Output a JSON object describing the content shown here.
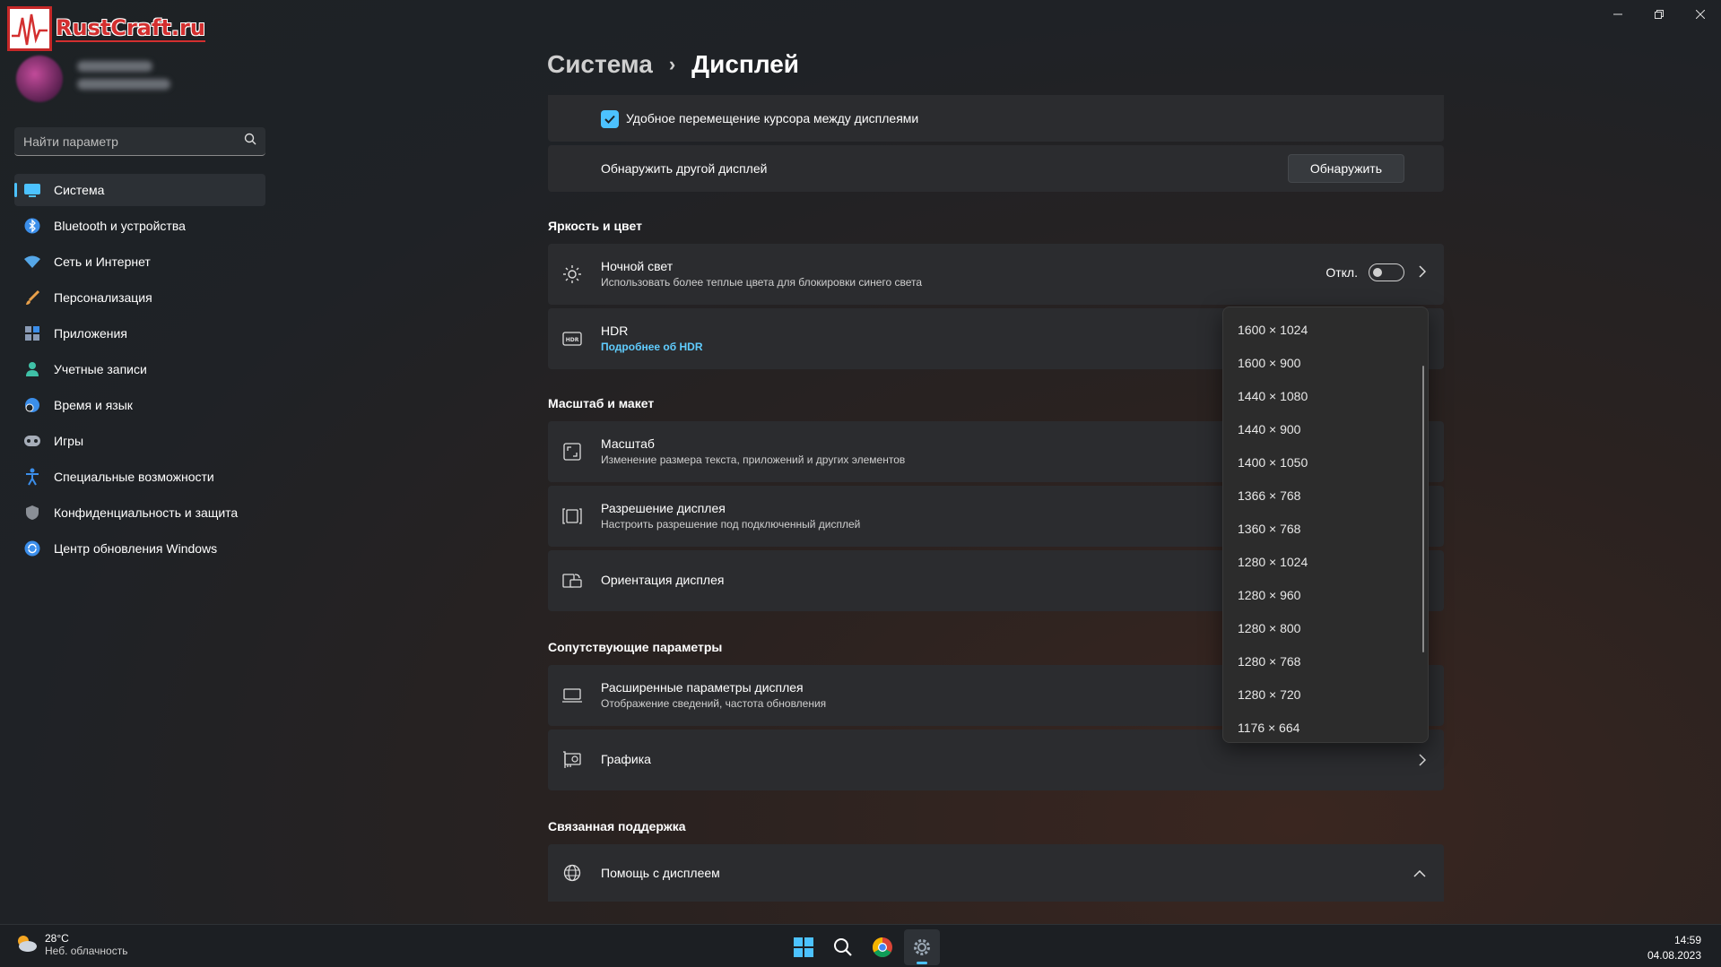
{
  "watermark": {
    "text": "RustCraft.ru"
  },
  "window": {
    "minimize": "–",
    "maximize": "⧉",
    "close": "✕"
  },
  "search": {
    "placeholder": "Найти параметр"
  },
  "sidebar": {
    "items": [
      {
        "label": "Система",
        "icon": "system-icon",
        "color": "#4cc2ff",
        "active": true
      },
      {
        "label": "Bluetooth и устройства",
        "icon": "bluetooth-icon",
        "color": "#3b8eea"
      },
      {
        "label": "Сеть и Интернет",
        "icon": "wifi-icon",
        "color": "#55a7e8"
      },
      {
        "label": "Персонализация",
        "icon": "brush-icon",
        "color": "#e8a04a"
      },
      {
        "label": "Приложения",
        "icon": "apps-icon",
        "color": "#8a9bb5"
      },
      {
        "label": "Учетные записи",
        "icon": "account-icon",
        "color": "#3fc1a7"
      },
      {
        "label": "Время и язык",
        "icon": "globe-clock-icon",
        "color": "#3b8eea"
      },
      {
        "label": "Игры",
        "icon": "gamepad-icon",
        "color": "#a6adb8"
      },
      {
        "label": "Специальные возможности",
        "icon": "accessibility-icon",
        "color": "#3b8eea"
      },
      {
        "label": "Конфиденциальность и защита",
        "icon": "shield-icon",
        "color": "#8a8f96"
      },
      {
        "label": "Центр обновления Windows",
        "icon": "update-icon",
        "color": "#3b8eea"
      }
    ]
  },
  "header": {
    "crumb": "Система",
    "separator": "›",
    "title": "Дисплей"
  },
  "main": {
    "cursor_move": "Удобное перемещение курсора между дисплеями",
    "detect_label": "Обнаружить другой дисплей",
    "detect_button": "Обнаружить",
    "section_brightness": "Яркость и цвет",
    "night_light": {
      "title": "Ночной свет",
      "subtitle": "Использовать более теплые цвета для блокировки синего света",
      "state": "Откл."
    },
    "hdr": {
      "title": "HDR",
      "link": "Подробнее об HDR"
    },
    "section_scale": "Масштаб и макет",
    "scale": {
      "title": "Масштаб",
      "subtitle": "Изменение размера текста, приложений и других элементов"
    },
    "resolution": {
      "title": "Разрешение дисплея",
      "subtitle": "Настроить разрешение под подключенный дисплей"
    },
    "orientation": {
      "title": "Ориентация дисплея"
    },
    "section_related": "Сопутствующие параметры",
    "advanced": {
      "title": "Расширенные параметры дисплея",
      "subtitle": "Отображение сведений, частота обновления"
    },
    "graphics": {
      "title": "Графика"
    },
    "section_support": "Связанная поддержка",
    "help": {
      "title": "Помощь с дисплеем"
    }
  },
  "resolution_dropdown": {
    "options": [
      "1600 × 1024",
      "1600 × 900",
      "1440 × 1080",
      "1440 × 900",
      "1400 × 1050",
      "1366 × 768",
      "1360 × 768",
      "1280 × 1024",
      "1280 × 960",
      "1280 × 800",
      "1280 × 768",
      "1280 × 720",
      "1176 × 664"
    ]
  },
  "taskbar": {
    "weather_temp": "28°C",
    "weather_desc": "Неб. облачность",
    "time": "14:59",
    "date": "04.08.2023"
  }
}
